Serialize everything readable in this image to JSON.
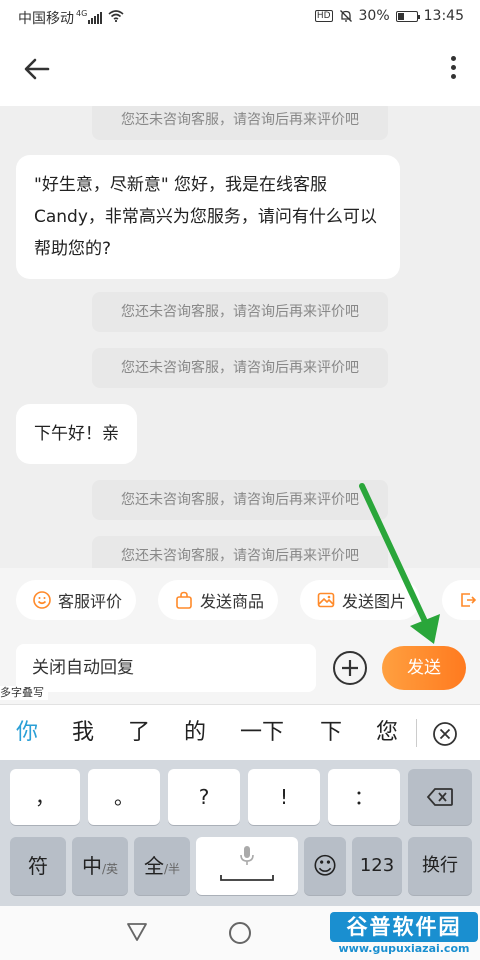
{
  "status_bar": {
    "carrier": "中国移动",
    "network": "4G",
    "hd": "HD",
    "battery": "30%",
    "battery_fraction": 0.3,
    "time": "13:45"
  },
  "header": {
    "back_icon": "arrow-left-icon",
    "more_icon": "more-vertical-icon"
  },
  "chat": {
    "system_notice": "您还未咨询客服，请咨询后再来评价吧",
    "messages": [
      {
        "type": "system",
        "text": "您还未咨询客服，请咨询后再来评价吧"
      },
      {
        "type": "bubble",
        "text": "\"好生意，尽新意\" 您好，我是在线客服Candy，非常高兴为您服务，请问有什么可以帮助您的?"
      },
      {
        "type": "system",
        "text": "您还未咨询客服，请咨询后再来评价吧"
      },
      {
        "type": "system",
        "text": "您还未咨询客服，请咨询后再来评价吧"
      },
      {
        "type": "bubble",
        "text": "下午好！亲"
      },
      {
        "type": "system",
        "text": "您还未咨询客服，请咨询后再来评价吧"
      },
      {
        "type": "system",
        "text": "您还未咨询客服，请咨询后再来评价吧"
      }
    ]
  },
  "quick_actions": [
    {
      "label": "客服评价",
      "icon": "smiley-icon"
    },
    {
      "label": "发送商品",
      "icon": "bag-icon"
    },
    {
      "label": "发送图片",
      "icon": "image-icon"
    },
    {
      "label": "",
      "icon": "exit-icon"
    }
  ],
  "input": {
    "value": "关闭自动回复",
    "send_label": "发送",
    "plus_icon": "plus-icon"
  },
  "ime": {
    "hint": "多字叠写",
    "candidates": [
      "你",
      "我",
      "了",
      "的",
      "一下",
      "下",
      "您"
    ],
    "row1": [
      "，",
      "。",
      "?",
      "!",
      "：",
      "⌫"
    ],
    "row2": {
      "symbols": "符",
      "zh": "中",
      "zh_sub": "/英",
      "full": "全",
      "full_sub": "/半",
      "emoji": "☺",
      "num": "123",
      "enter": "换行"
    },
    "accent_color": "#2a9fd6"
  },
  "annotation": {
    "arrow_color": "#2aa63a"
  },
  "watermark": {
    "logo": "谷普软件园",
    "url": "www.gupuxiazai.com"
  }
}
